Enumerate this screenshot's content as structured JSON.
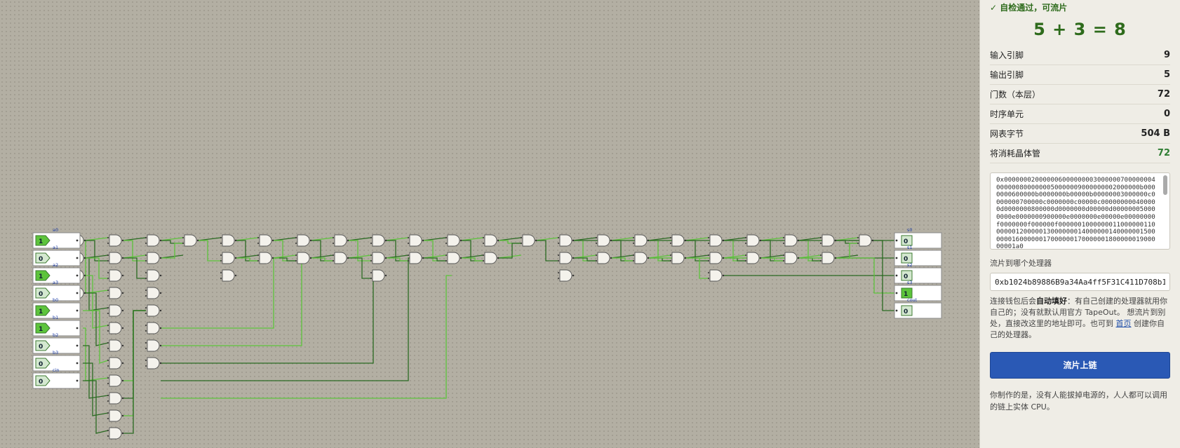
{
  "panel": {
    "status": "✓ 自检通过，可流片",
    "formula": "5 + 3 = 8",
    "stats": [
      {
        "label": "输入引脚",
        "value": "9"
      },
      {
        "label": "输出引脚",
        "value": "5"
      },
      {
        "label": "门数（本层）",
        "value": "72"
      },
      {
        "label": "时序单元",
        "value": "0"
      },
      {
        "label": "网表字节",
        "value": "504 B"
      },
      {
        "label": "将消耗晶体管",
        "value": "72"
      }
    ],
    "netlist": "0x0000000200000060000000030000007000000040000008000000050000009000000002000000b0000000600000b0000000b00000b00000003000000c0000000700000c0000000c00000c000000000400000d0000000800000d0000000d00000d000000050000000e0000000900000e0000000e00000e00000000f0000000f000000f0000001000000011000000110000001200000130000000140000001400000015000000160000001700000017000000180000001900000001a0",
    "processor_label": "流片到哪个处理器",
    "processor_address": "0xb1024b89886B9a34Aa4ff5F31C411D708b1",
    "desc_1": "连接钱包后会",
    "desc_bold": "自动填好",
    "desc_2": "：有自己创建的处理器就用你自己的；没有就默认用官方 TapeOut。 想流片到别处，直接改这里的地址即可。也可到 ",
    "desc_link": "首页",
    "desc_3": " 创建你自己的处理器。",
    "button": "流片上链",
    "footer": "你制作的是，没有人能拔掉电源的，人人都可以调用的链上实体 CPU。"
  },
  "circuit": {
    "inputs": [
      {
        "name": "a0",
        "value": "1"
      },
      {
        "name": "a1",
        "value": "0"
      },
      {
        "name": "a2",
        "value": "1"
      },
      {
        "name": "a3",
        "value": "0"
      },
      {
        "name": "b0",
        "value": "1"
      },
      {
        "name": "b1",
        "value": "1"
      },
      {
        "name": "b2",
        "value": "0"
      },
      {
        "name": "b3",
        "value": "0"
      },
      {
        "name": "cin",
        "value": "0"
      }
    ],
    "outputs": [
      {
        "name": "s0",
        "value": "0"
      },
      {
        "name": "s1",
        "value": "0"
      },
      {
        "name": "s2",
        "value": "0"
      },
      {
        "name": "s3",
        "value": "1"
      },
      {
        "name": "cout",
        "value": "0"
      }
    ],
    "gate_columns": [
      {
        "count": 4
      },
      {
        "count": 12
      },
      {
        "count": 8
      },
      {
        "count": 1
      },
      {
        "count": 3
      },
      {
        "count": 2
      },
      {
        "count": 2
      },
      {
        "count": 2
      },
      {
        "count": 3
      },
      {
        "count": 2
      },
      {
        "count": 2
      },
      {
        "count": 2
      },
      {
        "count": 1
      },
      {
        "count": 3
      },
      {
        "count": 2
      },
      {
        "count": 2
      },
      {
        "count": 2
      },
      {
        "count": 3
      },
      {
        "count": 2
      },
      {
        "count": 2
      },
      {
        "count": 2
      },
      {
        "count": 1
      }
    ],
    "colors": {
      "on": "#5dc43c",
      "off": "#2a6a22",
      "pin_on": "#5dc43c",
      "pin_off": "#d4e8d0",
      "label": "#1f3fa8"
    }
  }
}
